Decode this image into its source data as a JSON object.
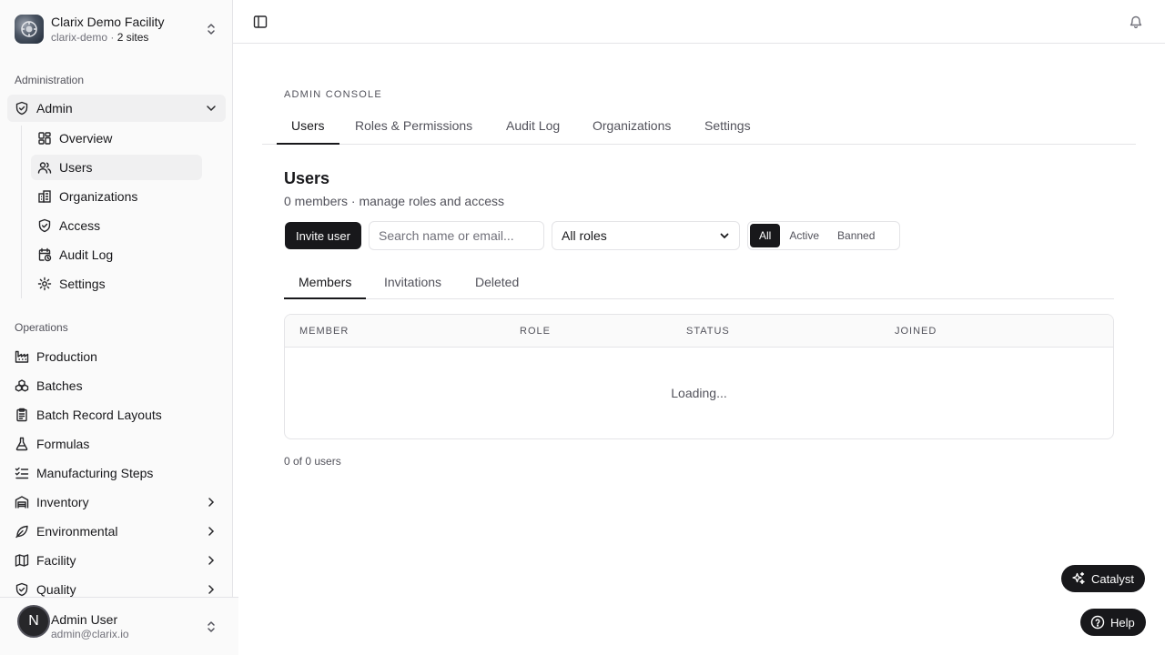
{
  "org": {
    "name": "Clarix Demo Facility",
    "slug": "clarix-demo",
    "separator": " · ",
    "sites": "2 sites"
  },
  "sidebar": {
    "admin_section": "Administration",
    "admin": {
      "label": "Admin",
      "icon": "shield-check-icon"
    },
    "admin_items": [
      {
        "label": "Overview",
        "icon": "dashboard-icon"
      },
      {
        "label": "Users",
        "icon": "users-icon",
        "active": true
      },
      {
        "label": "Organizations",
        "icon": "building-icon"
      },
      {
        "label": "Access",
        "icon": "shield-check-icon"
      },
      {
        "label": "Audit Log",
        "icon": "calendar-clock-icon"
      },
      {
        "label": "Settings",
        "icon": "gear-icon"
      }
    ],
    "ops_section": "Operations",
    "ops_items": [
      {
        "label": "Production",
        "icon": "factory-icon"
      },
      {
        "label": "Batches",
        "icon": "boxes-icon"
      },
      {
        "label": "Batch Record Layouts",
        "icon": "clipboard-icon"
      },
      {
        "label": "Formulas",
        "icon": "flask-icon"
      },
      {
        "label": "Manufacturing Steps",
        "icon": "list-checks-icon"
      },
      {
        "label": "Inventory",
        "icon": "warehouse-icon"
      },
      {
        "label": "Environmental",
        "icon": "leaf-icon"
      },
      {
        "label": "Facility",
        "icon": "map-icon"
      },
      {
        "label": "Quality",
        "icon": "shield-check-icon"
      }
    ]
  },
  "user": {
    "initial": "N",
    "name": "Admin User",
    "email": "admin@clarix.io"
  },
  "main": {
    "eyebrow": "ADMIN CONSOLE",
    "tabs": [
      "Users",
      "Roles & Permissions",
      "Audit Log",
      "Organizations",
      "Settings"
    ],
    "title": "Users",
    "subtitle": "0 members · manage roles and access",
    "invite_label": "Invite user",
    "search_placeholder": "Search name or email...",
    "role_filter": "All roles",
    "status_filters": [
      "All",
      "Active",
      "Banned"
    ],
    "sub_tabs": [
      "Members",
      "Invitations",
      "Deleted"
    ],
    "columns": [
      "MEMBER",
      "ROLE",
      "STATUS",
      "JOINED"
    ],
    "loading": "Loading...",
    "count": "0 of 0 users"
  },
  "fabs": {
    "catalyst": "Catalyst",
    "help": "Help"
  },
  "colors": {
    "primary": "#18181b",
    "border": "#e4e4e7",
    "muted": "#52525b"
  }
}
